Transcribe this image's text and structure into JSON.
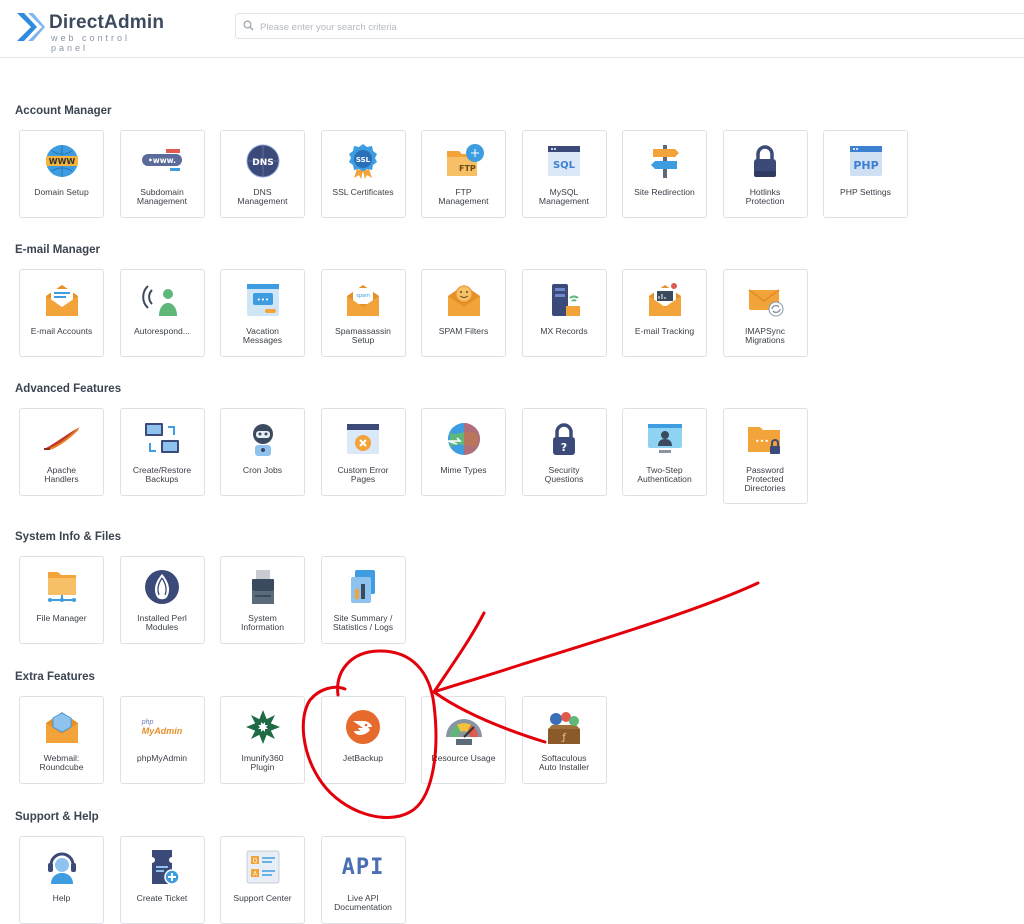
{
  "brand": {
    "name": "DirectAdmin",
    "tagline": "web control panel",
    "color": "#3c4a5e"
  },
  "search": {
    "placeholder": "Please enter your search criteria",
    "value": ""
  },
  "colors": {
    "annotation": "#e3000b",
    "tile_border": "#dde1e6",
    "accent_blue": "#2f8ae0",
    "accent_orange": "#f2a33a"
  },
  "sections": [
    {
      "title": "Account Manager",
      "items": [
        {
          "label": "Domain Setup",
          "icon": "www-globe-icon"
        },
        {
          "label": "Subdomain\nManagement",
          "icon": "subdomain-icon"
        },
        {
          "label": "DNS\nManagement",
          "icon": "dns-globe-icon"
        },
        {
          "label": "SSL Certificates",
          "icon": "ssl-badge-icon"
        },
        {
          "label": "FTP\nManagement",
          "icon": "ftp-folder-icon"
        },
        {
          "label": "MySQL\nManagement",
          "icon": "sql-window-icon"
        },
        {
          "label": "Site Redirection",
          "icon": "signpost-icon"
        },
        {
          "label": "Hotlinks\nProtection",
          "icon": "padlock-icon"
        },
        {
          "label": "PHP Settings",
          "icon": "php-window-icon"
        }
      ]
    },
    {
      "title": "E-mail Manager",
      "items": [
        {
          "label": "E-mail Accounts",
          "icon": "envelope-icon"
        },
        {
          "label": "Autorespond...",
          "icon": "autoresponder-icon"
        },
        {
          "label": "Vacation\nMessages",
          "icon": "chat-window-icon"
        },
        {
          "label": "Spamassassin\nSetup",
          "icon": "spam-envelope-icon"
        },
        {
          "label": "SPAM Filters",
          "icon": "smiley-envelope-icon"
        },
        {
          "label": "MX Records",
          "icon": "server-icon"
        },
        {
          "label": "E-mail Tracking",
          "icon": "tracking-envelope-icon"
        },
        {
          "label": "IMAPSync\nMigrations",
          "icon": "sync-envelope-icon"
        }
      ]
    },
    {
      "title": "Advanced Features",
      "items": [
        {
          "label": "Apache\nHandlers",
          "icon": "apache-feather-icon"
        },
        {
          "label": "Create/Restore\nBackups",
          "icon": "backup-monitors-icon"
        },
        {
          "label": "Cron Jobs",
          "icon": "robot-icon"
        },
        {
          "label": "Custom Error\nPages",
          "icon": "error-window-icon"
        },
        {
          "label": "Mime Types",
          "icon": "mime-globe-icon"
        },
        {
          "label": "Security\nQuestions",
          "icon": "question-lock-icon"
        },
        {
          "label": "Two-Step\nAuthentication",
          "icon": "two-step-monitor-icon"
        },
        {
          "label": "Password\nProtected\nDirectories",
          "icon": "locked-folder-icon"
        }
      ]
    },
    {
      "title": "System Info & Files",
      "items": [
        {
          "label": "File Manager",
          "icon": "folder-network-icon"
        },
        {
          "label": "Installed Perl\nModules",
          "icon": "perl-onion-icon"
        },
        {
          "label": "System\nInformation",
          "icon": "printer-icon"
        },
        {
          "label": "Site Summary /\nStatistics / Logs",
          "icon": "stats-document-icon"
        }
      ]
    },
    {
      "title": "Extra Features",
      "items": [
        {
          "label": "Webmail:\nRoundcube",
          "icon": "roundcube-icon"
        },
        {
          "label": "phpMyAdmin",
          "icon": "phpmyadmin-logo-icon",
          "logo_top": "php",
          "logo_bottom": "MyAdmin"
        },
        {
          "label": "Imunify360\nPlugin",
          "icon": "imunify-icon"
        },
        {
          "label": "JetBackup",
          "icon": "jetbackup-icon"
        },
        {
          "label": "Resource Usage",
          "icon": "gauge-icon"
        },
        {
          "label": "Softaculous\nAuto Installer",
          "icon": "softaculous-icon"
        }
      ]
    },
    {
      "title": "Support & Help",
      "items": [
        {
          "label": "Help",
          "icon": "headset-icon"
        },
        {
          "label": "Create Ticket",
          "icon": "ticket-icon"
        },
        {
          "label": "Support Center",
          "icon": "support-window-icon"
        },
        {
          "label": "Live API\nDocumentation",
          "icon": "api-text-icon",
          "icon_text": "API"
        }
      ]
    }
  ]
}
